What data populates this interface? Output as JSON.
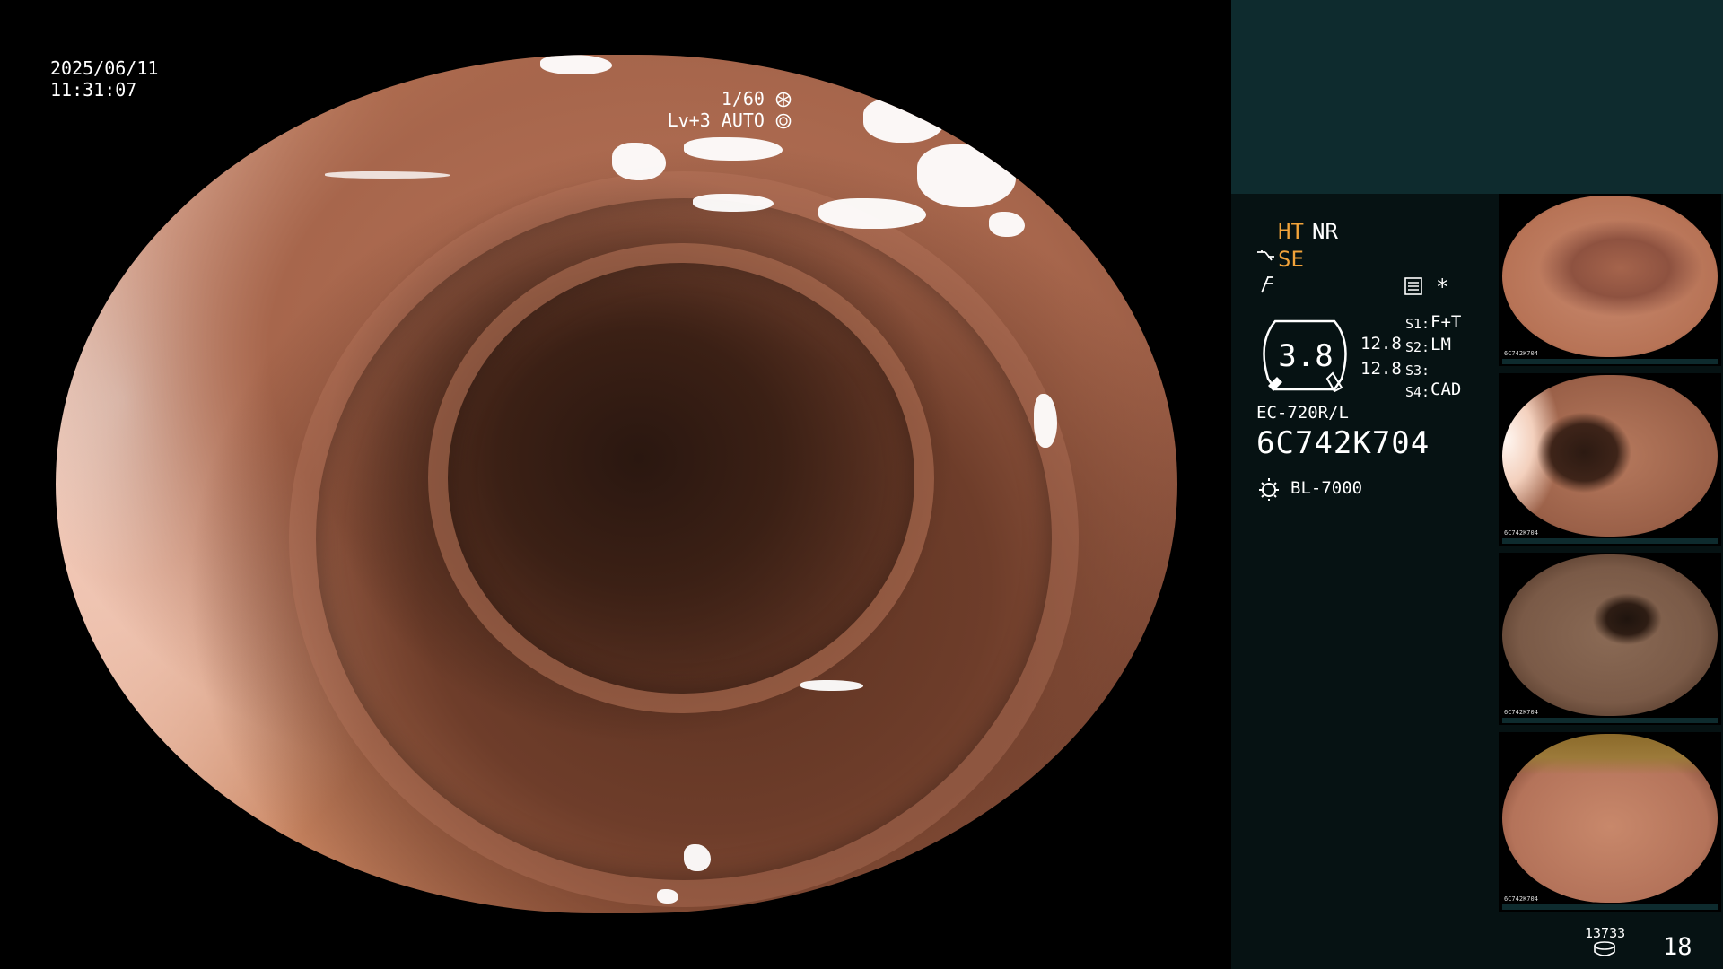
{
  "overlay": {
    "date": "2025/06/11",
    "time": "11:31:07",
    "shutter": "1/60",
    "level_mode": "Lv+3 AUTO"
  },
  "status": {
    "ht": "HT",
    "nr": "NR",
    "se": "SE",
    "star": "*"
  },
  "gauge": {
    "value": "3.8",
    "val_a": "12.8",
    "val_b": "12.8"
  },
  "slots": [
    {
      "label": "S1:",
      "value": "F+T"
    },
    {
      "label": "S2:",
      "value": "LM"
    },
    {
      "label": "S3:",
      "value": ""
    },
    {
      "label": "S4:",
      "value": "CAD"
    }
  ],
  "scope": {
    "model": "EC-720R/L",
    "serial": "6C742K704",
    "light_source": "BL-7000"
  },
  "thumbnails": [
    {
      "id": "6C742K704"
    },
    {
      "id": "6C742K704"
    },
    {
      "id": "6C742K704"
    },
    {
      "id": "6C742K704"
    }
  ],
  "footer": {
    "frame_count": "13733",
    "page_number": "18"
  },
  "colors": {
    "accent_orange": "#f2a33a",
    "panel_teal": "#0e2b2e",
    "panel_dark": "#061213"
  },
  "icons": {
    "shutter": "aperture-icon",
    "auto": "iris-icon",
    "se": "structure-enhance-icon",
    "f": "freeze-icon",
    "menu": "menu-icon",
    "light": "light-source-icon",
    "storage": "storage-icon"
  }
}
